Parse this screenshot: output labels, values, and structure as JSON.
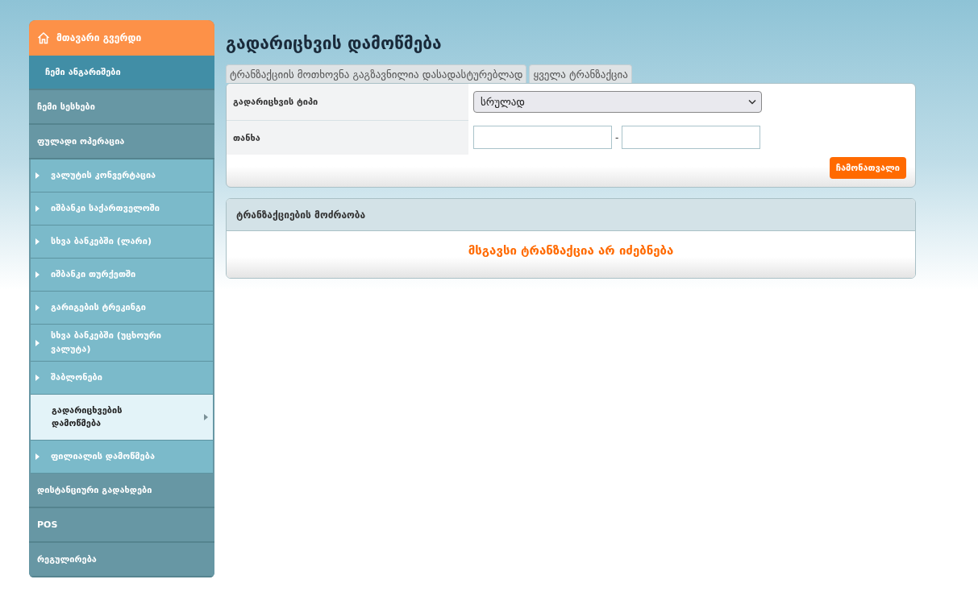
{
  "sidebar": {
    "items": [
      {
        "label": "მთავარი გვერდი",
        "kind": "home"
      },
      {
        "label": "ჩემი ანგარიშები",
        "kind": "sub"
      },
      {
        "label": "ჩემი სესხები",
        "kind": "top"
      },
      {
        "label": "ფულადი ოპერაცია",
        "kind": "top",
        "expanded": true,
        "children": [
          {
            "label": "ვალუტის კონვერტაცია",
            "selected": false
          },
          {
            "label": "იშბანკი საქართველოში",
            "selected": false
          },
          {
            "label": "სხვა ბანკებში (ლარი)",
            "selected": false
          },
          {
            "label": "იშბანკი თურქეთში",
            "selected": false
          },
          {
            "label": "გარიგების ტრეკინგი",
            "selected": false
          },
          {
            "label": "სხვა ბანკებში (უცხოური ვალუტა)",
            "selected": false
          },
          {
            "label": "შაბლონები",
            "selected": false
          },
          {
            "label": "გადარიცხვების დამოწმება",
            "selected": true
          },
          {
            "label": "ფილიალის დამოწმება",
            "selected": false
          }
        ]
      },
      {
        "label": "დისტანციური გადახდები",
        "kind": "top"
      },
      {
        "label": "POS",
        "kind": "top"
      },
      {
        "label": "რეგულირება",
        "kind": "top"
      }
    ]
  },
  "page_title": "გადარიცხვის დამოწმება",
  "tabs": [
    {
      "label": "ტრანზაქციის მოთხოვნა გაგზავნილია დასადასტურებლად"
    },
    {
      "label": "ყველა ტრანზაქცია"
    }
  ],
  "filter_form": {
    "type_label": "გადარიცხვის ტიპი",
    "type_value": "სრულად",
    "amount_label": "თანხა",
    "range_separator": "-",
    "submit_button": "ჩამონათვალი"
  },
  "results": {
    "title": "ტრანზაქციების მოძრაობა",
    "empty_message": "მსგავსი ტრანზაქცია არ იძებნება"
  }
}
